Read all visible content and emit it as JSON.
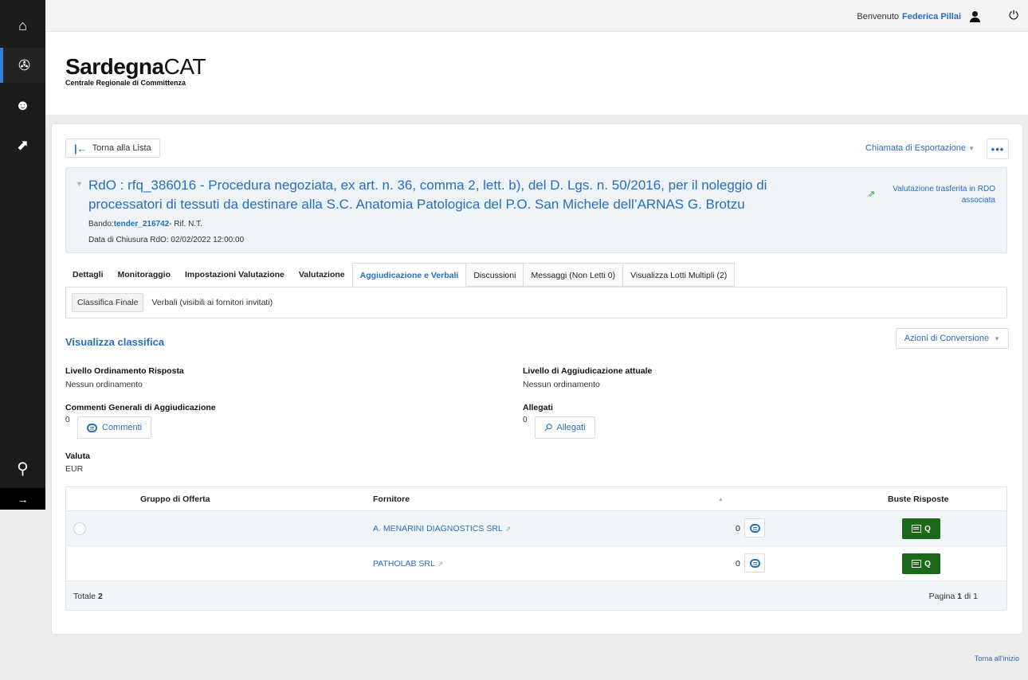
{
  "topbar": {
    "welcome_label": "Benvenuto",
    "user_name": "Federica Pillai"
  },
  "brand": {
    "title_bold": "Sardegna",
    "title_light": "CAT",
    "subtitle": "Centrale Regionale di Committenza"
  },
  "toolbar": {
    "back_label": "Torna alla Lista",
    "export_label": "Chiamata di Esportazione",
    "more_label": "•••"
  },
  "rdo": {
    "title": "RdO : rfq_386016 - Procedura negoziata, ex art. n. 36, comma 2, lett. b), del D. Lgs. n. 50/2016, per il noleggio di processatori di tessuti da destinare alla S.C. Anatomia Patologica del P.O. San Michele dell’ARNAS G. Brotzu",
    "bando_label": "Bando:",
    "bando_value": "tender_216742",
    "rif_label": "- Rif. N.T.",
    "closing_date": "Data di Chiusura RdO: 02/02/2022 12:00:00",
    "transfer_note": "Valutazione trasferita in RDO associata"
  },
  "tabs": [
    {
      "label": "Dettagli"
    },
    {
      "label": "Monitoraggio"
    },
    {
      "label": "Impostazioni Valutazione"
    },
    {
      "label": "Valutazione"
    },
    {
      "label": "Aggiudicazione e Verbali"
    },
    {
      "label": "Discussioni"
    },
    {
      "label": "Messaggi (Non Letti 0)"
    },
    {
      "label": "Visualizza Lotti Multipli (2)"
    }
  ],
  "subtabs": [
    {
      "label": "Classifica Finale"
    },
    {
      "label": "Verbali (visibili ai fornitori invitati)"
    }
  ],
  "section": {
    "title": "Visualizza classifica",
    "conversion_label": "Azioni di Conversione"
  },
  "fields": {
    "order_level_label": "Livello Ordinamento Risposta",
    "order_level_value": "Nessun ordinamento",
    "award_level_label": "Livello di Aggiudicazione attuale",
    "award_level_value": "Nessun ordinamento",
    "comments_label": "Commenti Generali di Aggiudicazione",
    "comments_count": "0",
    "comments_button": "Commenti",
    "attachments_label": "Allegati",
    "attachments_count": "0",
    "attachments_button": "Allegati",
    "currency_label": "Valuta",
    "currency_value": "EUR"
  },
  "table": {
    "headers": {
      "group": "Gruppo di Offerta",
      "supplier": "Fornitore",
      "sort_indicator": "▲",
      "envelopes": "Buste Risposte"
    },
    "rows": [
      {
        "supplier": "A. MENARINI DIAGNOSTICS SRL",
        "count": "0",
        "envelope_label": "Q"
      },
      {
        "supplier": "PATHOLAB SRL",
        "count": "0",
        "envelope_label": "Q"
      }
    ],
    "footer": {
      "total_label": "Totale",
      "total_value": "2",
      "page_label": "Pagina",
      "page_current": "1",
      "page_of": "di 1"
    }
  },
  "footer": {
    "back_to_top": "Torna all'inizio"
  },
  "colors": {
    "accent": "#2a6ebb",
    "rail": "#1b1b1b",
    "action_green": "#1a6a1a"
  }
}
